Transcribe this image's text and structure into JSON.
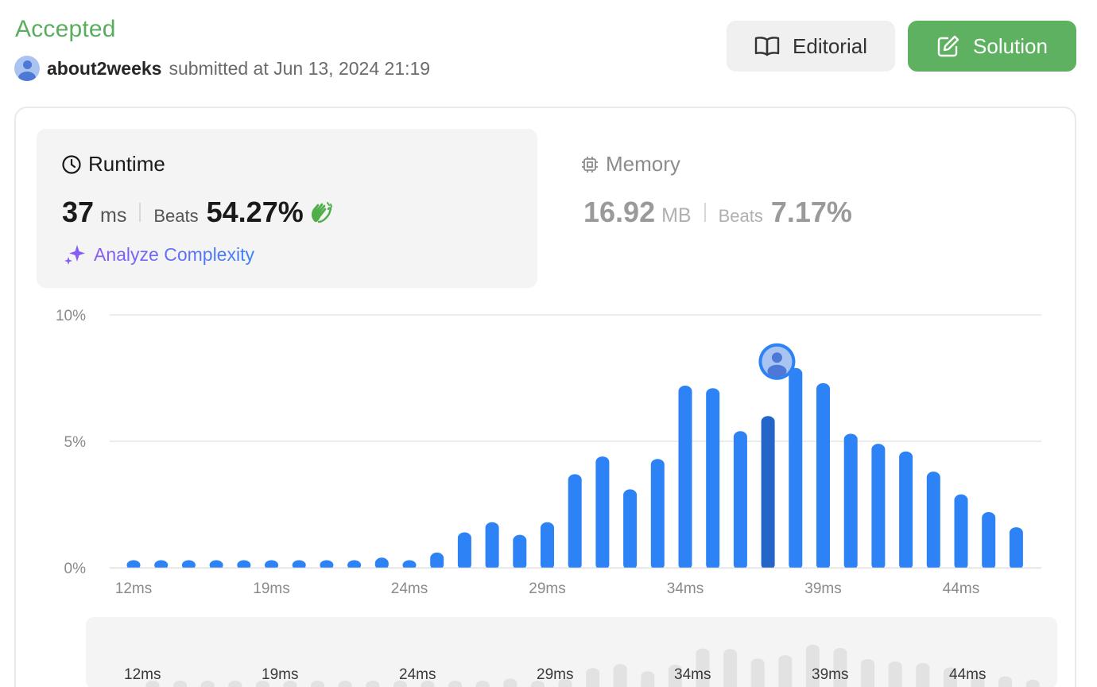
{
  "header": {
    "status": "Accepted",
    "username": "about2weeks",
    "submitted_text": "submitted at Jun 13, 2024 21:19"
  },
  "buttons": {
    "editorial": "Editorial",
    "solution": "Solution"
  },
  "runtime": {
    "title": "Runtime",
    "value": "37",
    "unit": "ms",
    "beats_label": "Beats",
    "beats": "54.27%",
    "analyze": "Analyze Complexity"
  },
  "memory": {
    "title": "Memory",
    "value": "16.92",
    "unit": "MB",
    "beats_label": "Beats",
    "beats": "7.17%"
  },
  "colors": {
    "accepted": "#5aad5f",
    "bar": "#2d82f5",
    "bar_selected": "#2466c8",
    "solution_button": "#5db160"
  },
  "chart_data": {
    "type": "bar",
    "y_tick_labels": [
      "10%",
      "5%",
      "0%"
    ],
    "ylim": [
      0,
      10
    ],
    "grid": true,
    "x_tick_labels": [
      "12ms",
      "19ms",
      "24ms",
      "29ms",
      "34ms",
      "39ms",
      "44ms"
    ],
    "x_tick_bar_index": [
      0,
      5,
      10,
      15,
      20,
      25,
      30
    ],
    "values": [
      0.3,
      0.3,
      0.3,
      0.3,
      0.3,
      0.3,
      0.3,
      0.3,
      0.3,
      0.4,
      0.3,
      0.6,
      1.4,
      1.8,
      1.3,
      1.8,
      3.7,
      4.4,
      3.1,
      4.3,
      7.2,
      7.1,
      5.4,
      6.0,
      7.9,
      7.3,
      5.3,
      4.9,
      4.6,
      3.8,
      2.9,
      2.2,
      1.6
    ],
    "selected_index": 23,
    "navigator": {
      "x_tick_labels": [
        "12ms",
        "19ms",
        "24ms",
        "29ms",
        "34ms",
        "39ms",
        "44ms"
      ]
    }
  }
}
